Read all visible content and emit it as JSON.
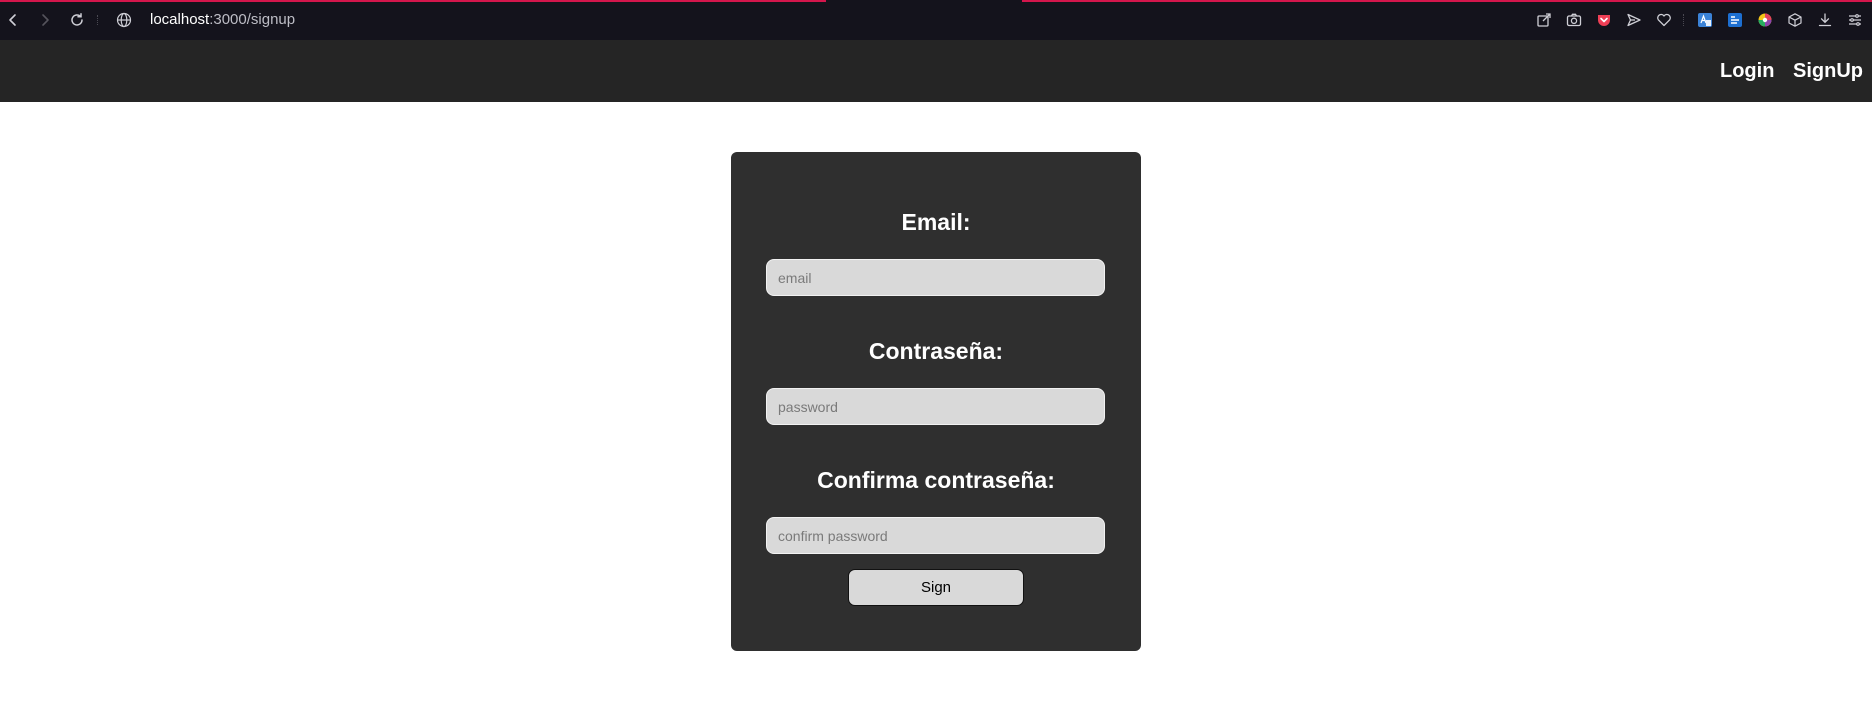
{
  "browser": {
    "url_host": "localhost",
    "url_rest": ":3000/signup",
    "nav_icons": [
      "back-arrow-icon",
      "forward-arrow-icon",
      "reload-icon",
      "globe-icon"
    ],
    "toolbar_icons": [
      "share-icon",
      "camera-icon",
      "pocket-icon",
      "send-icon",
      "heart-icon",
      "translate-icon",
      "extension-icon",
      "color-picker-icon",
      "box-icon",
      "download-icon",
      "menu-icon"
    ],
    "accent_color": "#d4164c"
  },
  "header": {
    "login_label": "Login",
    "signup_label": "SignUp"
  },
  "form": {
    "email_label": "Email:",
    "email_placeholder": "email",
    "email_value": "",
    "password_label": "Contraseña:",
    "password_placeholder": "password",
    "password_value": "",
    "confirm_label": "Confirma contraseña:",
    "confirm_placeholder": "confirm password",
    "confirm_value": "",
    "submit_label": "Sign"
  },
  "colors": {
    "header_bg": "#252525",
    "card_bg": "#2f2f2f",
    "input_bg": "#d9d9d9",
    "page_bg": "#ffffff"
  }
}
